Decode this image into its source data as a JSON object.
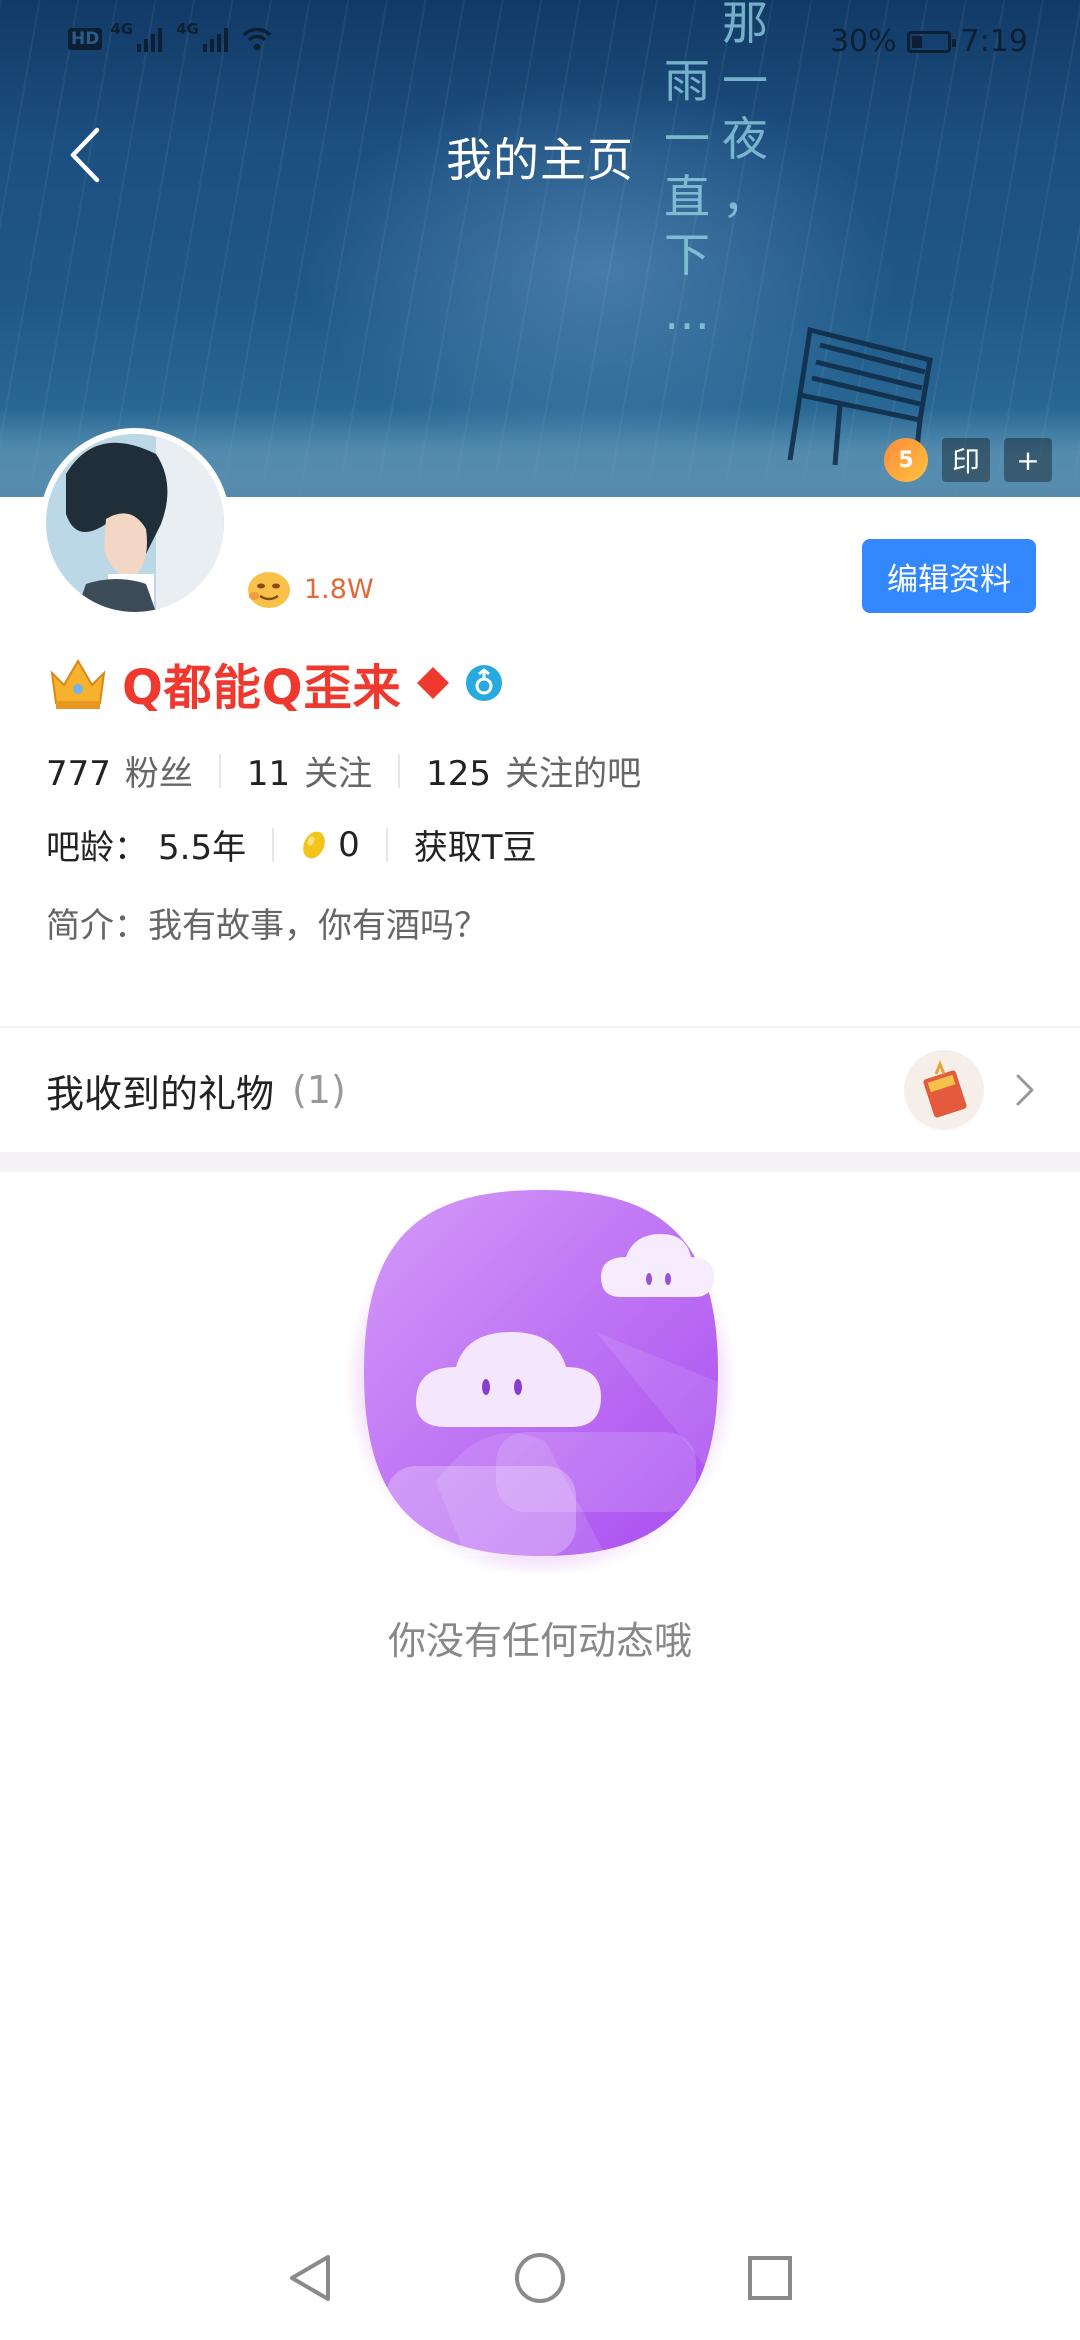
{
  "status_bar": {
    "hd": "HD",
    "net1": "4G",
    "net2": "4G",
    "battery_text": "30%",
    "time": "7:19"
  },
  "header": {
    "title": "我的主页",
    "banner_poem_col1": [
      "那",
      "一",
      "夜",
      "，"
    ],
    "banner_poem_col2": [
      "雨",
      "一",
      "直",
      "下",
      "…"
    ],
    "badge_level": "5",
    "stamp_label": "印",
    "add_label": "+"
  },
  "profile": {
    "fans_level_count": "1.8W",
    "edit_button": "编辑资料",
    "username": "Q都能Q歪来",
    "stats": [
      {
        "value": "777",
        "label": "粉丝"
      },
      {
        "value": "11",
        "label": "关注"
      },
      {
        "value": "125",
        "label": "关注的吧"
      }
    ],
    "age_label": "吧龄：",
    "age_value": "5.5年",
    "tdou_value": "0",
    "get_tdou": "获取T豆",
    "intro": "简介：我有故事，你有酒吗？"
  },
  "gifts": {
    "title": "我收到的礼物",
    "count": "(1)"
  },
  "empty_state": {
    "message": "你没有任何动态哦"
  },
  "colors": {
    "accent": "#3388ff",
    "username": "#f0392e",
    "fans": "#e06a3a",
    "illus_purple": "#b46cf5"
  },
  "icons": {
    "back": "back-arrow-icon",
    "home": "home-circle-icon",
    "recents": "recents-square-icon",
    "nav_back": "nav-back-triangle-icon"
  }
}
